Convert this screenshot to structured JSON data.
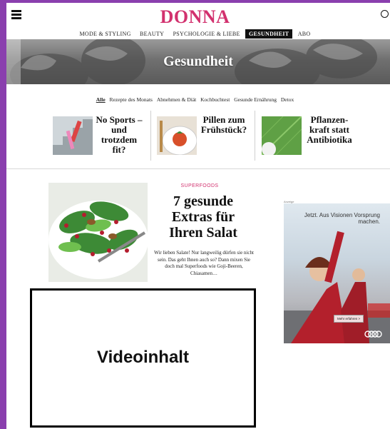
{
  "header": {
    "logo": "DONNA",
    "menu_icon": "hamburger-menu-icon",
    "search_icon": "search-icon"
  },
  "main_nav": [
    {
      "label": "MODE & STYLING",
      "active": false
    },
    {
      "label": "BEAUTY",
      "active": false
    },
    {
      "label": "PSYCHOLOGIE & LIEBE",
      "active": false
    },
    {
      "label": "GESUNDHEIT",
      "active": true
    },
    {
      "label": "ABO",
      "active": false
    }
  ],
  "hero": {
    "title": "Gesundheit"
  },
  "sub_nav": [
    {
      "label": "Alle",
      "active": true
    },
    {
      "label": "Rezepte des Monats",
      "active": false
    },
    {
      "label": "Abnehmen & Diät",
      "active": false
    },
    {
      "label": "Kochbuchtest",
      "active": false
    },
    {
      "label": "Gesunde Ernährung",
      "active": false
    },
    {
      "label": "Detox",
      "active": false
    }
  ],
  "teasers": [
    {
      "title": "No Sports – und trotzdem fit?"
    },
    {
      "title": "Pillen zum Frühstück?"
    },
    {
      "title": "Pflanzen-kraft statt Antibiotika"
    }
  ],
  "article": {
    "kicker": "SUPERFOODS",
    "title": "7 gesunde Extras für Ihren Salat",
    "teaser": "Wir lieben Salate! Nur langweilig dürfen sie nicht sein. Das geht Ihnen auch so? Dann mixen Sie doch mal Superfoods wie Goji-Beeren, Chiasamen…"
  },
  "video": {
    "label": "Videoinhalt"
  },
  "ad": {
    "label": "Anzeige",
    "headline": "Jetzt. Aus Visionen Vorsprung machen.",
    "cta": "Mehr erfahren >"
  },
  "colors": {
    "brand": "#d2316e",
    "frame": "#8a3fae"
  }
}
